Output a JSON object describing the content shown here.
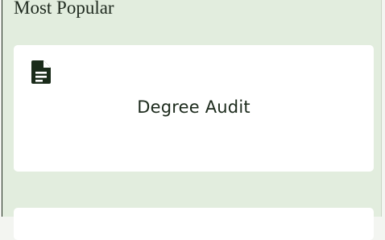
{
  "section": {
    "title": "Most Popular"
  },
  "cards": [
    {
      "label": "Degree Audit",
      "icon": "document-icon"
    }
  ],
  "colors": {
    "panel_background": "#e2edde",
    "card_background": "#ffffff",
    "text": "#1c2a1c",
    "icon": "#1a2b1a"
  }
}
